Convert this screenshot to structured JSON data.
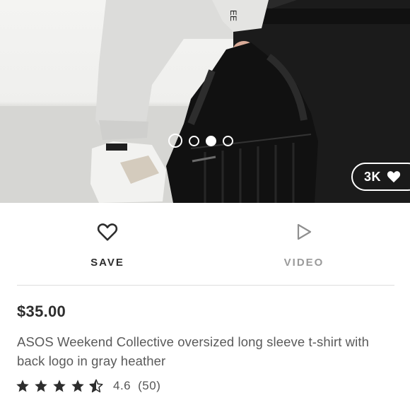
{
  "product_image": {
    "description_icon": "product-photo",
    "carousel": {
      "total": 4,
      "active_index": 2
    },
    "likes": {
      "count": "3K",
      "icon": "heart-icon"
    }
  },
  "actions": {
    "save": {
      "label": "SAVE",
      "icon": "heart-outline-icon"
    },
    "video": {
      "label": "VIDEO",
      "icon": "play-outline-icon"
    }
  },
  "product": {
    "price": "$35.00",
    "title": "ASOS Weekend Collective oversized long sleeve t-shirt with back logo in gray heather",
    "rating": {
      "value": "4.6",
      "count": "(50)",
      "stars": 4.5
    }
  },
  "colors": {
    "text_primary": "#2d2d2d",
    "text_secondary": "#5a5a5a",
    "muted": "#9a9a9a",
    "divider": "#dddddd"
  }
}
